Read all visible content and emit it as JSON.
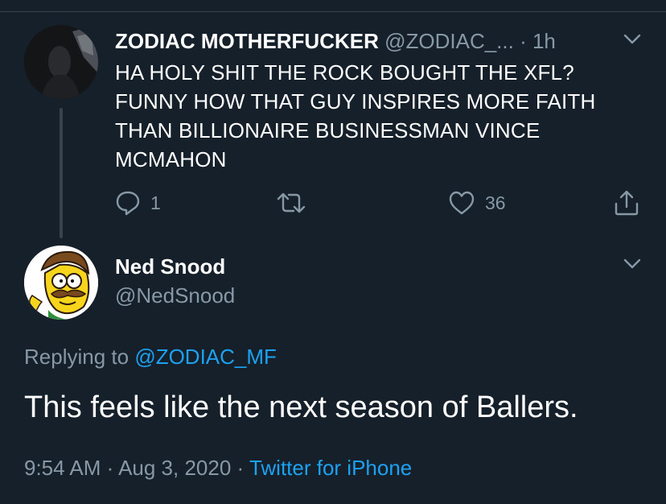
{
  "parent_tweet": {
    "display_name": "ZODIAC MOTHERFUCKER",
    "handle": "@ZODIAC_...",
    "time": "· 1h",
    "text": "HA HOLY SHIT THE ROCK BOUGHT THE XFL?\nFUNNY HOW THAT GUY INSPIRES MORE FAITH\nTHAN BILLIONAIRE BUSINESSMAN VINCE\nMCMAHON",
    "reply_count": "1",
    "retweet_count": "",
    "like_count": "36"
  },
  "reply_tweet": {
    "display_name": "Ned Snood",
    "handle": "@NedSnood",
    "replying_to_label": "Replying to",
    "replying_to_handle": "@ZODIAC_MF",
    "text": "This feels like the next season of Ballers.",
    "timestamp": "9:54 AM · Aug 3, 2020 ·",
    "source": "Twitter for iPhone"
  },
  "colors": {
    "background": "#15202b",
    "secondary_text": "#8899a6",
    "link": "#1da1f2",
    "divider": "#38444d"
  },
  "icons": {
    "reply": "comment-icon",
    "retweet": "retweet-icon",
    "like": "heart-icon",
    "share": "share-icon",
    "menu": "chevron-down-icon"
  }
}
